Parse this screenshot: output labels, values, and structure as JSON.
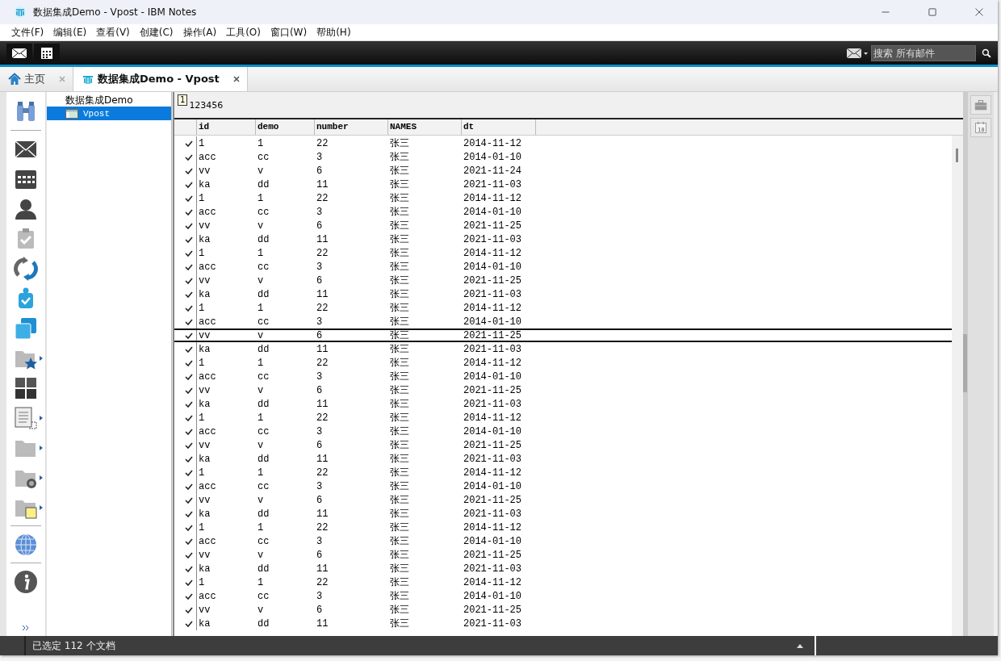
{
  "window": {
    "title": "数据集成Demo - Vpost - IBM Notes"
  },
  "menu": [
    "文件(F)",
    "编辑(E)",
    "查看(V)",
    "创建(C)",
    "操作(A)",
    "工具(O)",
    "窗口(W)",
    "帮助(H)"
  ],
  "toolbar": {
    "search": {
      "placeholder": "搜索 所有邮件"
    }
  },
  "tabs": [
    {
      "label": "主页",
      "selected": false,
      "kind": "home"
    },
    {
      "label": "数据集成Demo - Vpost",
      "selected": true,
      "kind": "database"
    }
  ],
  "navigator": {
    "title": "数据集成Demo",
    "items": [
      {
        "label": "Vpost",
        "selected": true
      }
    ]
  },
  "view": {
    "marker": "1",
    "heading": "123456",
    "columns": [
      "id",
      "demo",
      "number",
      "NAMES",
      "dt"
    ],
    "rows": [
      {
        "cells": [
          "1",
          "1",
          "22",
          "张三",
          "2014-11-12"
        ],
        "checked": true,
        "selected": false
      },
      {
        "cells": [
          "acc",
          "cc",
          "3",
          "张三",
          "2014-01-10"
        ],
        "checked": true,
        "selected": false
      },
      {
        "cells": [
          "vv",
          "v",
          "6",
          "张三",
          "2021-11-24"
        ],
        "checked": true,
        "selected": false
      },
      {
        "cells": [
          "ka",
          "dd",
          "11",
          "张三",
          "2021-11-03"
        ],
        "checked": true,
        "selected": false
      },
      {
        "cells": [
          "1",
          "1",
          "22",
          "张三",
          "2014-11-12"
        ],
        "checked": true,
        "selected": false
      },
      {
        "cells": [
          "acc",
          "cc",
          "3",
          "张三",
          "2014-01-10"
        ],
        "checked": true,
        "selected": false
      },
      {
        "cells": [
          "vv",
          "v",
          "6",
          "张三",
          "2021-11-25"
        ],
        "checked": true,
        "selected": false
      },
      {
        "cells": [
          "ka",
          "dd",
          "11",
          "张三",
          "2021-11-03"
        ],
        "checked": true,
        "selected": false
      },
      {
        "cells": [
          "1",
          "1",
          "22",
          "张三",
          "2014-11-12"
        ],
        "checked": true,
        "selected": false
      },
      {
        "cells": [
          "acc",
          "cc",
          "3",
          "张三",
          "2014-01-10"
        ],
        "checked": true,
        "selected": false
      },
      {
        "cells": [
          "vv",
          "v",
          "6",
          "张三",
          "2021-11-25"
        ],
        "checked": true,
        "selected": false
      },
      {
        "cells": [
          "ka",
          "dd",
          "11",
          "张三",
          "2021-11-03"
        ],
        "checked": true,
        "selected": false
      },
      {
        "cells": [
          "1",
          "1",
          "22",
          "张三",
          "2014-11-12"
        ],
        "checked": true,
        "selected": false
      },
      {
        "cells": [
          "acc",
          "cc",
          "3",
          "张三",
          "2014-01-10"
        ],
        "checked": true,
        "selected": false
      },
      {
        "cells": [
          "vv",
          "v",
          "6",
          "张三",
          "2021-11-25"
        ],
        "checked": true,
        "selected": true
      },
      {
        "cells": [
          "ka",
          "dd",
          "11",
          "张三",
          "2021-11-03"
        ],
        "checked": true,
        "selected": false
      },
      {
        "cells": [
          "1",
          "1",
          "22",
          "张三",
          "2014-11-12"
        ],
        "checked": true,
        "selected": false
      },
      {
        "cells": [
          "acc",
          "cc",
          "3",
          "张三",
          "2014-01-10"
        ],
        "checked": true,
        "selected": false
      },
      {
        "cells": [
          "vv",
          "v",
          "6",
          "张三",
          "2021-11-25"
        ],
        "checked": true,
        "selected": false
      },
      {
        "cells": [
          "ka",
          "dd",
          "11",
          "张三",
          "2021-11-03"
        ],
        "checked": true,
        "selected": false
      },
      {
        "cells": [
          "1",
          "1",
          "22",
          "张三",
          "2014-11-12"
        ],
        "checked": true,
        "selected": false
      },
      {
        "cells": [
          "acc",
          "cc",
          "3",
          "张三",
          "2014-01-10"
        ],
        "checked": true,
        "selected": false
      },
      {
        "cells": [
          "vv",
          "v",
          "6",
          "张三",
          "2021-11-25"
        ],
        "checked": true,
        "selected": false
      },
      {
        "cells": [
          "ka",
          "dd",
          "11",
          "张三",
          "2021-11-03"
        ],
        "checked": true,
        "selected": false
      },
      {
        "cells": [
          "1",
          "1",
          "22",
          "张三",
          "2014-11-12"
        ],
        "checked": true,
        "selected": false
      },
      {
        "cells": [
          "acc",
          "cc",
          "3",
          "张三",
          "2014-01-10"
        ],
        "checked": true,
        "selected": false
      },
      {
        "cells": [
          "vv",
          "v",
          "6",
          "张三",
          "2021-11-25"
        ],
        "checked": true,
        "selected": false
      },
      {
        "cells": [
          "ka",
          "dd",
          "11",
          "张三",
          "2021-11-03"
        ],
        "checked": true,
        "selected": false
      },
      {
        "cells": [
          "1",
          "1",
          "22",
          "张三",
          "2014-11-12"
        ],
        "checked": true,
        "selected": false
      },
      {
        "cells": [
          "acc",
          "cc",
          "3",
          "张三",
          "2014-01-10"
        ],
        "checked": true,
        "selected": false
      },
      {
        "cells": [
          "vv",
          "v",
          "6",
          "张三",
          "2021-11-25"
        ],
        "checked": true,
        "selected": false
      },
      {
        "cells": [
          "ka",
          "dd",
          "11",
          "张三",
          "2021-11-03"
        ],
        "checked": true,
        "selected": false
      },
      {
        "cells": [
          "1",
          "1",
          "22",
          "张三",
          "2014-11-12"
        ],
        "checked": true,
        "selected": false
      },
      {
        "cells": [
          "acc",
          "cc",
          "3",
          "张三",
          "2014-01-10"
        ],
        "checked": true,
        "selected": false
      },
      {
        "cells": [
          "vv",
          "v",
          "6",
          "张三",
          "2021-11-25"
        ],
        "checked": true,
        "selected": false
      },
      {
        "cells": [
          "ka",
          "dd",
          "11",
          "张三",
          "2021-11-03"
        ],
        "checked": true,
        "selected": false
      }
    ]
  },
  "right_panel": {
    "calendar_day": "18"
  },
  "status_bar": {
    "text": "已选定 112 个文档"
  }
}
